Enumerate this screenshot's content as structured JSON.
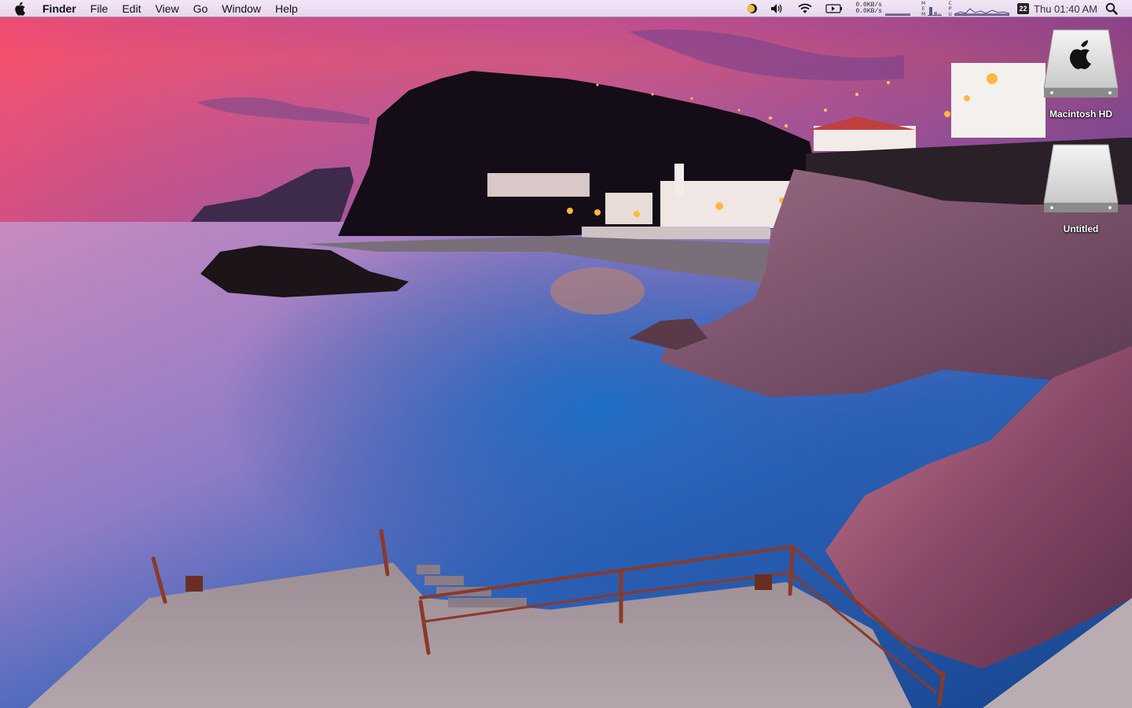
{
  "menubar": {
    "apple_icon": "apple-icon",
    "app_name": "Finder",
    "menus": [
      "File",
      "Edit",
      "View",
      "Go",
      "Window",
      "Help"
    ],
    "status": {
      "net_up": "0.0KB/s",
      "net_down": "0.0KB/s",
      "mem_label": "MEM",
      "cpu_label": "CPU",
      "calendar_day": "22",
      "clock": "Thu 01:40 AM"
    }
  },
  "desktop": {
    "icons": [
      {
        "label": "Macintosh HD",
        "icon": "hard-drive-apple-icon"
      },
      {
        "label": "Untitled",
        "icon": "hard-drive-icon"
      }
    ]
  },
  "colors": {
    "menubar_bg": "#ece0f2",
    "sky_top": "#c8497a",
    "sea": "#2c5fb4"
  }
}
